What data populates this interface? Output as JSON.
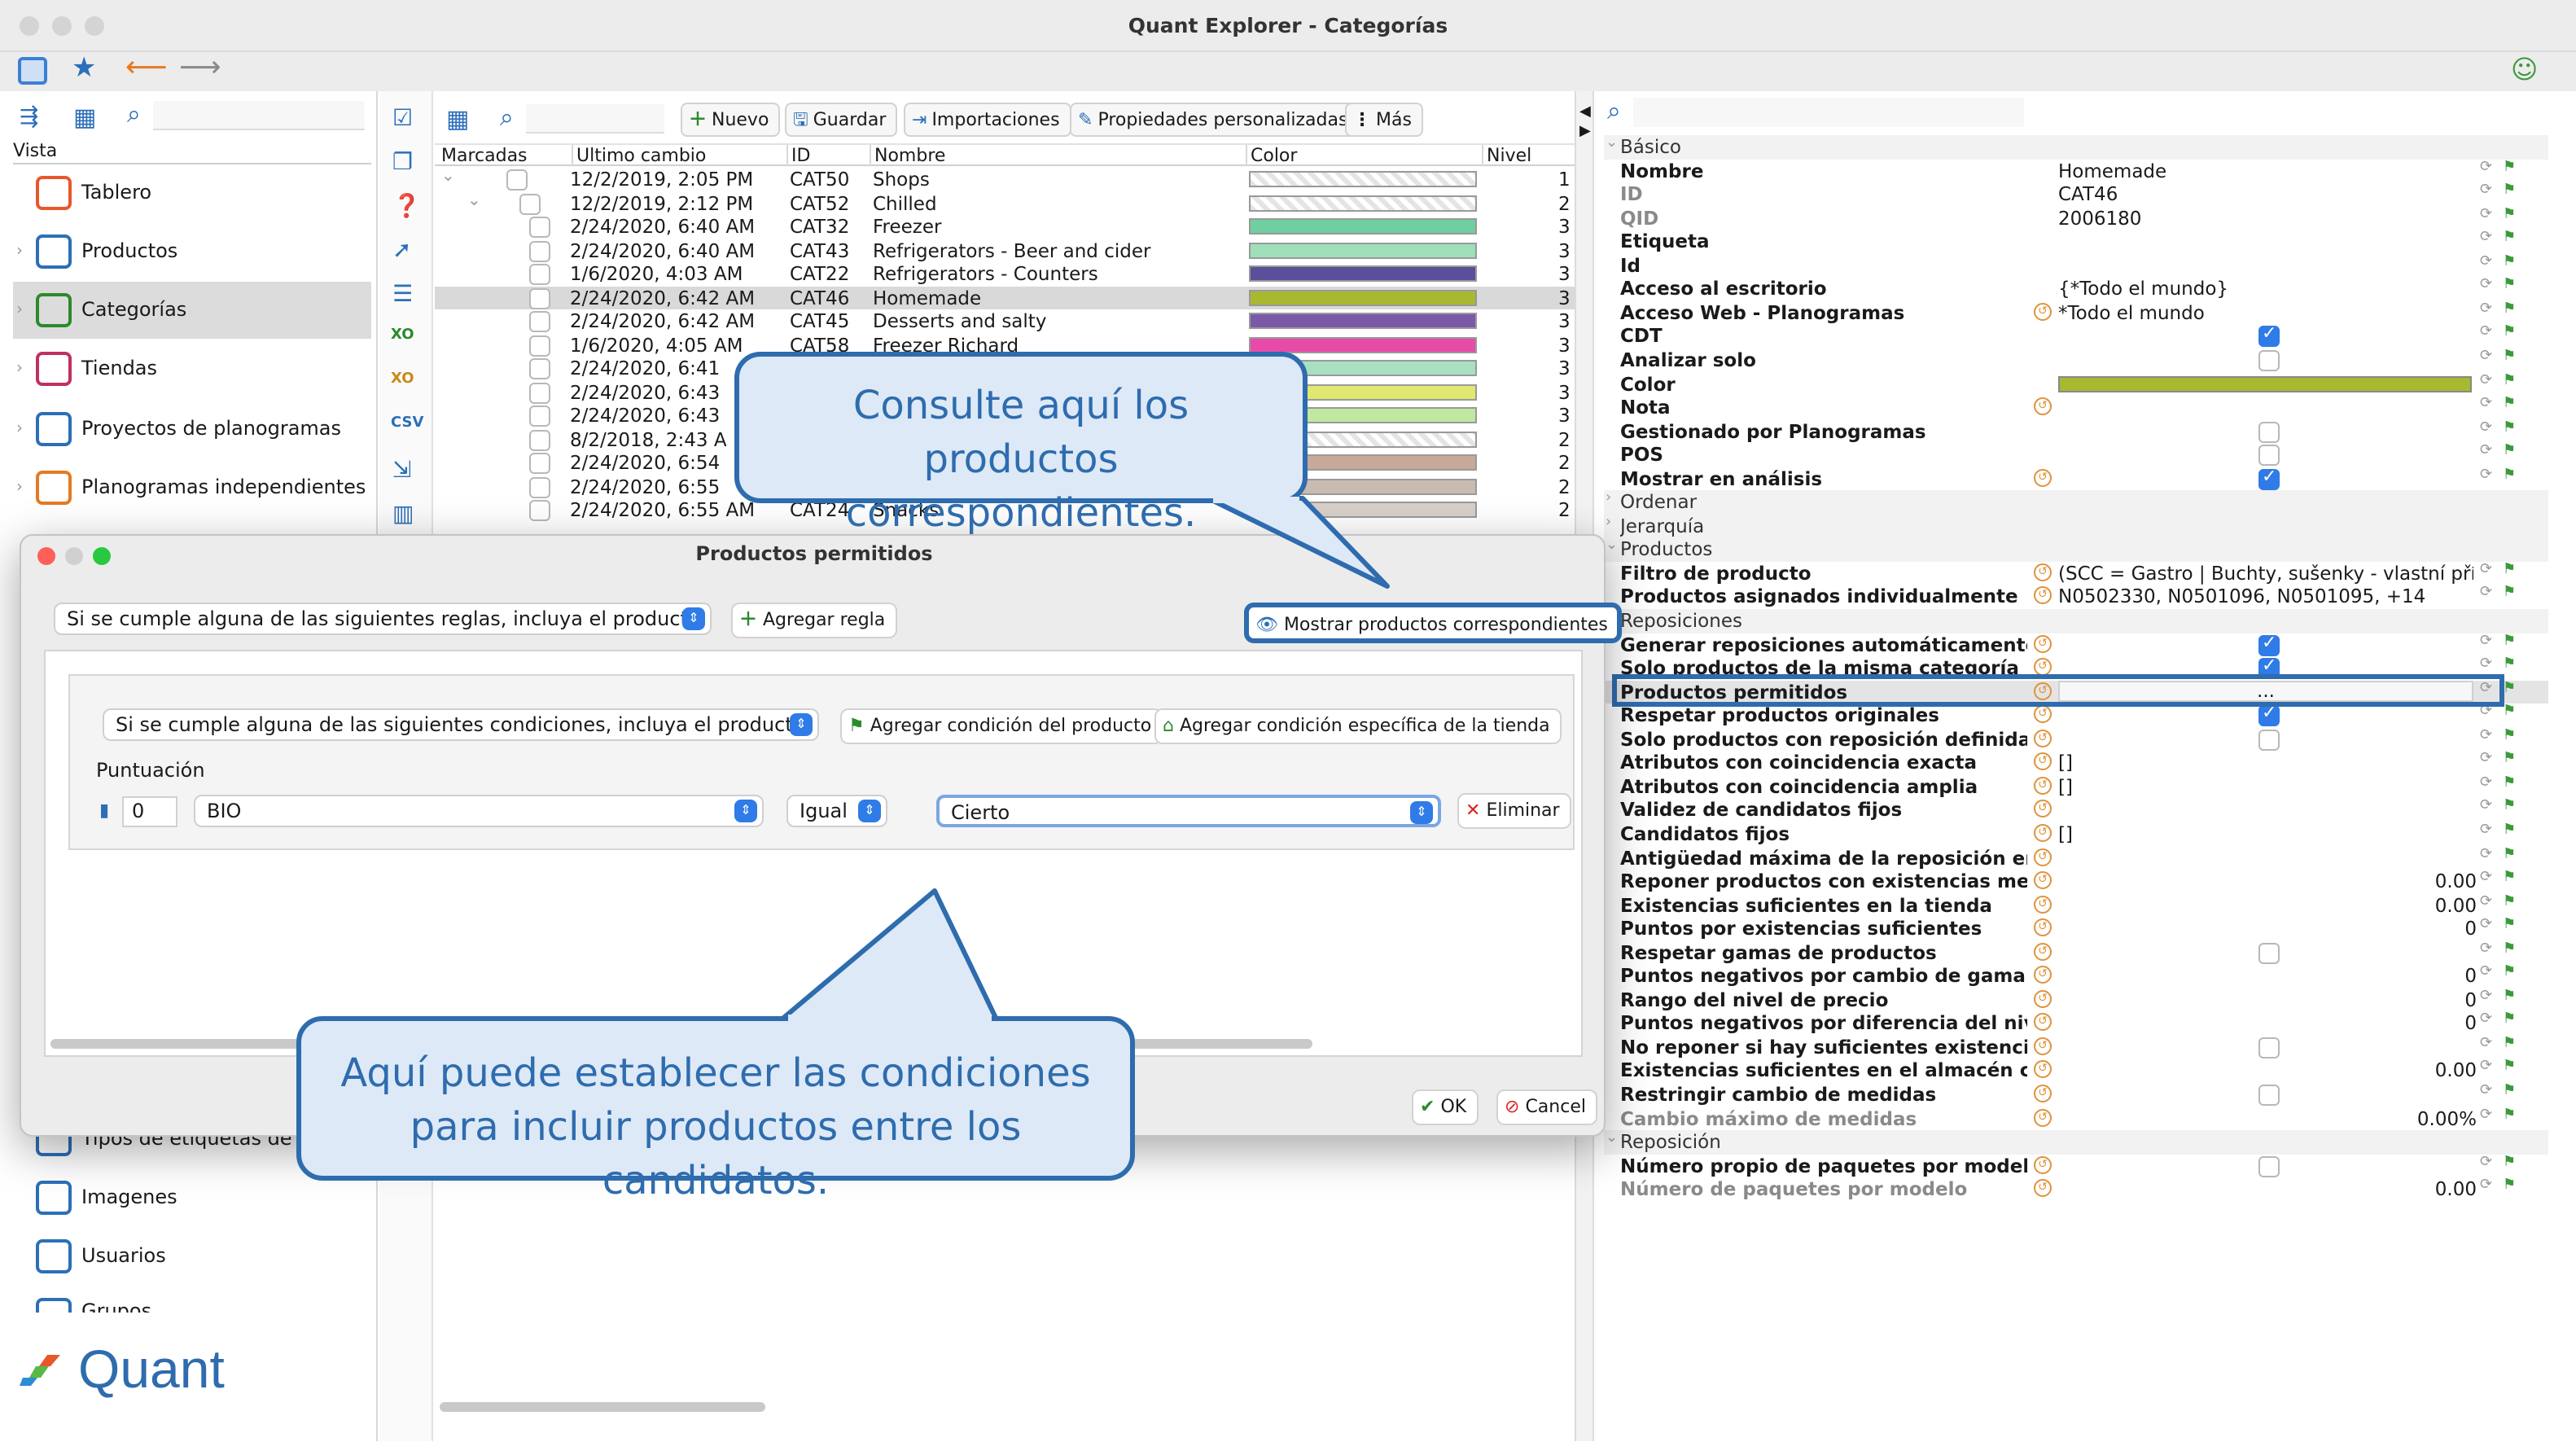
{
  "window": {
    "title": "Quant Explorer - Categorías"
  },
  "left_panel": {
    "header": "Vista",
    "items": [
      {
        "label": "Tablero",
        "icon": "dashboard-icon"
      },
      {
        "label": "Productos",
        "icon": "products-icon"
      },
      {
        "label": "Categorías",
        "icon": "categories-icon"
      },
      {
        "label": "Tiendas",
        "icon": "stores-icon"
      },
      {
        "label": "Proyectos de planogramas",
        "icon": "planogram-projects-icon"
      },
      {
        "label": "Planogramas independientes",
        "icon": "planograms-icon"
      }
    ],
    "lower_items": [
      {
        "label": "Tipos de etiquetas de pr",
        "icon": "label-types-icon"
      },
      {
        "label": "Imagenes",
        "icon": "images-icon"
      },
      {
        "label": "Usuarios",
        "icon": "users-icon"
      },
      {
        "label": "Grupos",
        "icon": "groups-icon"
      }
    ],
    "brand": "Quant"
  },
  "toolbar": {
    "new": "Nuevo",
    "save": "Guardar",
    "imports": "Importaciones",
    "custom_props": "Propiedades personalizadas",
    "more": "Más"
  },
  "table": {
    "columns": [
      "Marcadas",
      "Ultimo cambio",
      "ID",
      "Nombre",
      "Color",
      "Nivel"
    ],
    "rows": [
      {
        "date": "12/2/2019, 2:05 PM",
        "id": "CAT50",
        "name": "Shops",
        "color": "#f0f0f0",
        "level": "1"
      },
      {
        "date": "12/2/2019, 2:12 PM",
        "id": "CAT52",
        "name": "Chilled",
        "color": "#f0f0f0",
        "level": "2"
      },
      {
        "date": "2/24/2020, 6:40 AM",
        "id": "CAT32",
        "name": "Freezer",
        "color": "#6fcfa0",
        "level": "3"
      },
      {
        "date": "2/24/2020, 6:40 AM",
        "id": "CAT43",
        "name": "Refrigerators - Beer and cider",
        "color": "#9fe0b8",
        "level": "3"
      },
      {
        "date": "1/6/2020, 4:03 AM",
        "id": "CAT22",
        "name": "Refrigerators - Counters",
        "color": "#5a4f9a",
        "level": "3"
      },
      {
        "date": "2/24/2020, 6:42 AM",
        "id": "CAT46",
        "name": "Homemade",
        "color": "#a8b830",
        "level": "3"
      },
      {
        "date": "2/24/2020, 6:42 AM",
        "id": "CAT45",
        "name": "Desserts and salty",
        "color": "#7a5aa8",
        "level": "3"
      },
      {
        "date": "1/6/2020, 4:05 AM",
        "id": "CAT58",
        "name": "Freezer Richard",
        "color": "#e84aa8",
        "level": "3"
      },
      {
        "date": "2/24/2020, 6:41",
        "id": "",
        "name": "",
        "color": "#a8e0c0",
        "level": "3"
      },
      {
        "date": "2/24/2020, 6:43",
        "id": "",
        "name": "",
        "color": "#e0e870",
        "level": "3"
      },
      {
        "date": "2/24/2020, 6:43",
        "id": "",
        "name": "",
        "color": "#c0e8a0",
        "level": "3"
      },
      {
        "date": "8/2/2018, 2:43 A",
        "id": "",
        "name": "",
        "color": "#f0f0f0",
        "level": "2"
      },
      {
        "date": "2/24/2020, 6:54",
        "id": "",
        "name": "",
        "color": "#c8a898",
        "level": "2"
      },
      {
        "date": "2/24/2020, 6:55",
        "id": "",
        "name": "",
        "color": "#c8bcb0",
        "level": "2"
      },
      {
        "date": "2/24/2020, 6:55 AM",
        "id": "CAT24",
        "name": "Snacks",
        "color": "#d8d0c8",
        "level": "2"
      }
    ]
  },
  "properties": {
    "rows": [
      {
        "key": "Básico",
        "type": "section"
      },
      {
        "key": "Nombre",
        "value": "Homemade"
      },
      {
        "key": "ID",
        "value": "CAT46",
        "gray": true
      },
      {
        "key": "QID",
        "value": "2006180",
        "gray": true
      },
      {
        "key": "Etiqueta",
        "value": ""
      },
      {
        "key": "Id",
        "value": ""
      },
      {
        "key": "Acceso al escritorio",
        "value": "{*Todo el mundo}"
      },
      {
        "key": "Acceso Web - Planogramas",
        "value": "*Todo el mundo"
      },
      {
        "key": "CDT",
        "check": true
      },
      {
        "key": "Analizar solo",
        "check": false
      },
      {
        "key": "Color",
        "color": "#a8b830"
      },
      {
        "key": "Nota",
        "value": ""
      },
      {
        "key": "Gestionado por Planogramas",
        "check": false
      },
      {
        "key": "POS",
        "check": false
      },
      {
        "key": "Mostrar en análisis",
        "check": true
      },
      {
        "key": "Ordenar",
        "type": "section"
      },
      {
        "key": "Jerarquía",
        "type": "section"
      },
      {
        "key": "Productos",
        "type": "section"
      },
      {
        "key": "Filtro de producto",
        "value": "(SCC = Gastro | Buchty, sušenky - vlastní příp..."
      },
      {
        "key": "Productos asignados individualmente",
        "value": "N0502330, N0501096, N0501095, +14"
      },
      {
        "key": "Reposiciones",
        "type": "section"
      },
      {
        "key": "Generar reposiciones automáticamente",
        "check": true
      },
      {
        "key": "Solo productos de la misma categoría",
        "check": true
      },
      {
        "key": "Productos permitidos",
        "value": "...",
        "highlight": true
      },
      {
        "key": "Respetar productos originales",
        "check": true
      },
      {
        "key": "Solo productos con reposición definida",
        "check": false
      },
      {
        "key": "Atributos con coincidencia exacta",
        "value": "[]"
      },
      {
        "key": "Atributos con coincidencia amplia",
        "value": "[]"
      },
      {
        "key": "Validez de candidatos fijos",
        "value": ""
      },
      {
        "key": "Candidatos fijos",
        "value": "[]"
      },
      {
        "key": "Antigüedad máxima de la reposición en días",
        "value": ""
      },
      {
        "key": "Reponer productos con existencias menore...",
        "num": "0.00"
      },
      {
        "key": "Existencias suficientes en la tienda",
        "num": "0.00"
      },
      {
        "key": "Puntos por existencias suficientes",
        "num": "0"
      },
      {
        "key": "Respetar gamas de productos",
        "check": false
      },
      {
        "key": "Puntos negativos por cambio de gama de ...",
        "num": "0"
      },
      {
        "key": "Rango del nivel de precio",
        "num": "0"
      },
      {
        "key": "Puntos negativos por diferencia del nivel d...",
        "num": "0"
      },
      {
        "key": "No reponer si hay suficientes existencias e...",
        "check": false
      },
      {
        "key": "Existencias suficientes en el almacén central",
        "num": "0.00"
      },
      {
        "key": "Restringir cambio de medidas",
        "check": false
      },
      {
        "key": "Cambio máximo de medidas",
        "num": "0.00%",
        "gray": true
      },
      {
        "key": "Reposición",
        "type": "section"
      },
      {
        "key": "Número propio de paquetes por modelo",
        "check": false
      },
      {
        "key": "Número de paquetes por modelo",
        "num": "0.00",
        "gray": true
      }
    ]
  },
  "dialog": {
    "title": "Productos permitidos",
    "rule_mode": "Si se cumple alguna de las siguientes reglas, incluya el producto.",
    "add_rule": "Agregar regla",
    "show_matching": "Mostrar productos correspondientes",
    "condition_mode": "Si se cumple alguna de las siguientes condiciones, incluya el producto.",
    "add_product_condition": "Agregar condición del producto",
    "add_store_condition": "Agregar condición específica de la tienda",
    "score_label": "Puntuación",
    "score_value": "0",
    "field": "BIO",
    "operator": "Igual",
    "value": "Cierto",
    "remove": "Eliminar",
    "ok": "OK",
    "cancel": "Cancel"
  },
  "callouts": {
    "top": "Consulte aquí los productos correspondientes.",
    "bottom": "Aquí puede establecer las condiciones para incluir productos entre los candidatos."
  }
}
